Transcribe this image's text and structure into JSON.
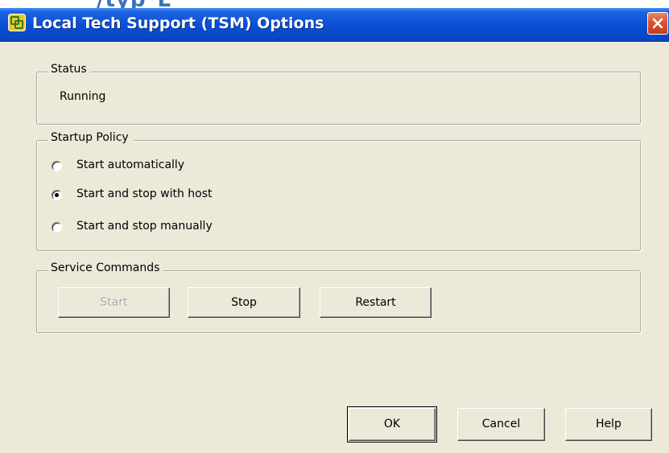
{
  "background_text": "/typ_L_",
  "window": {
    "title": "Local Tech Support (TSM) Options",
    "icon": "vmware-logo-icon",
    "close_icon": "close-icon"
  },
  "status": {
    "legend": "Status",
    "value": "Running"
  },
  "startup_policy": {
    "legend": "Startup Policy",
    "options": [
      {
        "label": "Start automatically",
        "selected": false
      },
      {
        "label": "Start and stop with host",
        "selected": true
      },
      {
        "label": "Start and stop manually",
        "selected": false
      }
    ]
  },
  "service_commands": {
    "legend": "Service Commands",
    "start_label": "Start",
    "start_enabled": false,
    "stop_label": "Stop",
    "restart_label": "Restart"
  },
  "footer": {
    "ok_label": "OK",
    "cancel_label": "Cancel",
    "help_label": "Help"
  },
  "colors": {
    "titlebar": "#0a4fd6",
    "dialog_background": "#ece9d8",
    "close_button": "#d9532e"
  }
}
